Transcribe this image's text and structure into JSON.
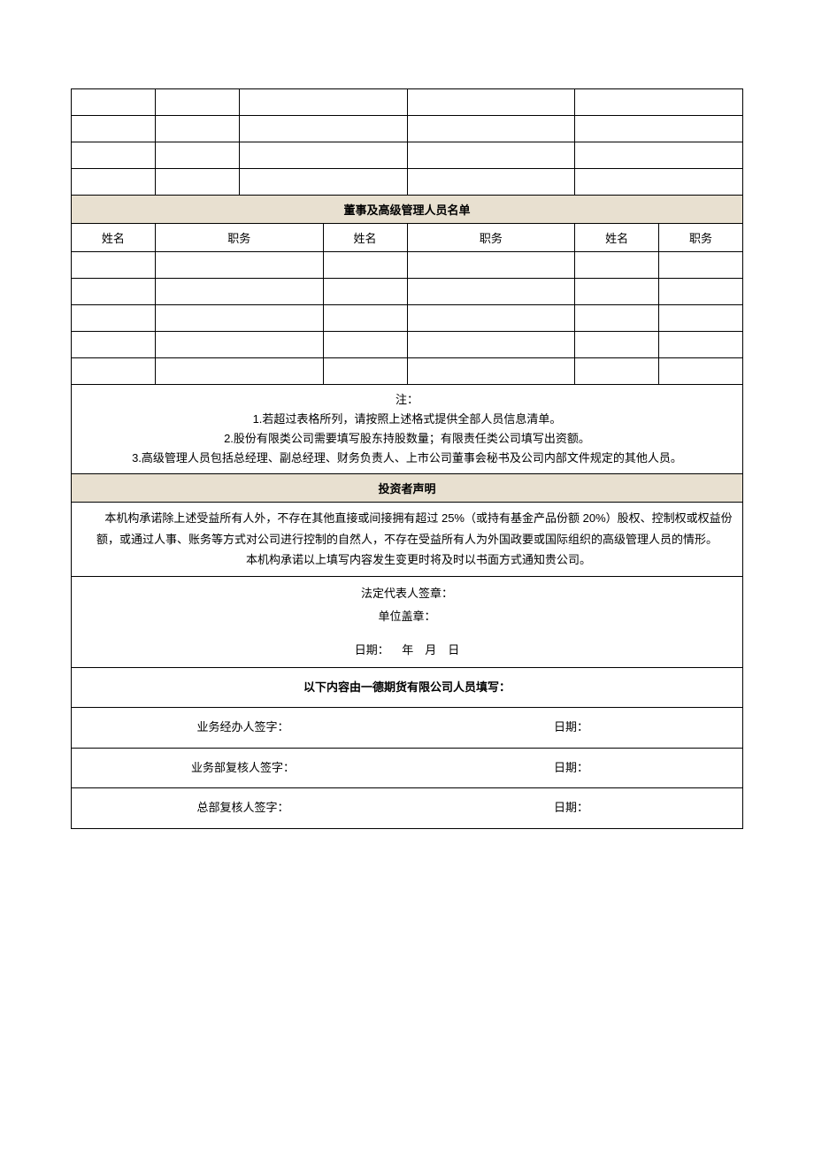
{
  "sections": {
    "directors_title": "董事及高级管理人员名单",
    "declaration_title": "投资者声明"
  },
  "dir_headers": {
    "name1": "姓名",
    "pos1": "职务",
    "name2": "姓名",
    "pos2": "职务",
    "name3": "姓名",
    "pos3": "职务"
  },
  "notes": {
    "label": "注：",
    "n1": "1.若超过表格所列，请按照上述格式提供全部人员信息清单。",
    "n2": "2.股份有限类公司需要填写股东持股数量；有限责任类公司填写出资额。",
    "n3": "3.高级管理人员包括总经理、副总经理、财务负责人、上市公司董事会秘书及公司内部文件规定的其他人员。"
  },
  "declaration": {
    "p1": "本机构承诺除上述受益所有人外，不存在其他直接或间接拥有超过 25%（或持有基金产品份额 20%）股权、控制权或权益份额，或通过人事、账务等方式对公司进行控制的自然人，不存在受益所有人为外国政要或国际组织的高级管理人员的情形。",
    "p2": "本机构承诺以上填写内容发生变更时将及时以书面方式通知贵公司。"
  },
  "signatures": {
    "legal_rep": "法定代表人签章：",
    "seal": "单位盖章：",
    "date_label": "日期：",
    "date_value": "年 月 日"
  },
  "footer": {
    "heading": "以下内容由一德期货有限公司人员填写：",
    "handler": "业务经办人签字：",
    "dept_reviewer": "业务部复核人签字：",
    "hq_reviewer": "总部复核人签字：",
    "date": "日期："
  }
}
